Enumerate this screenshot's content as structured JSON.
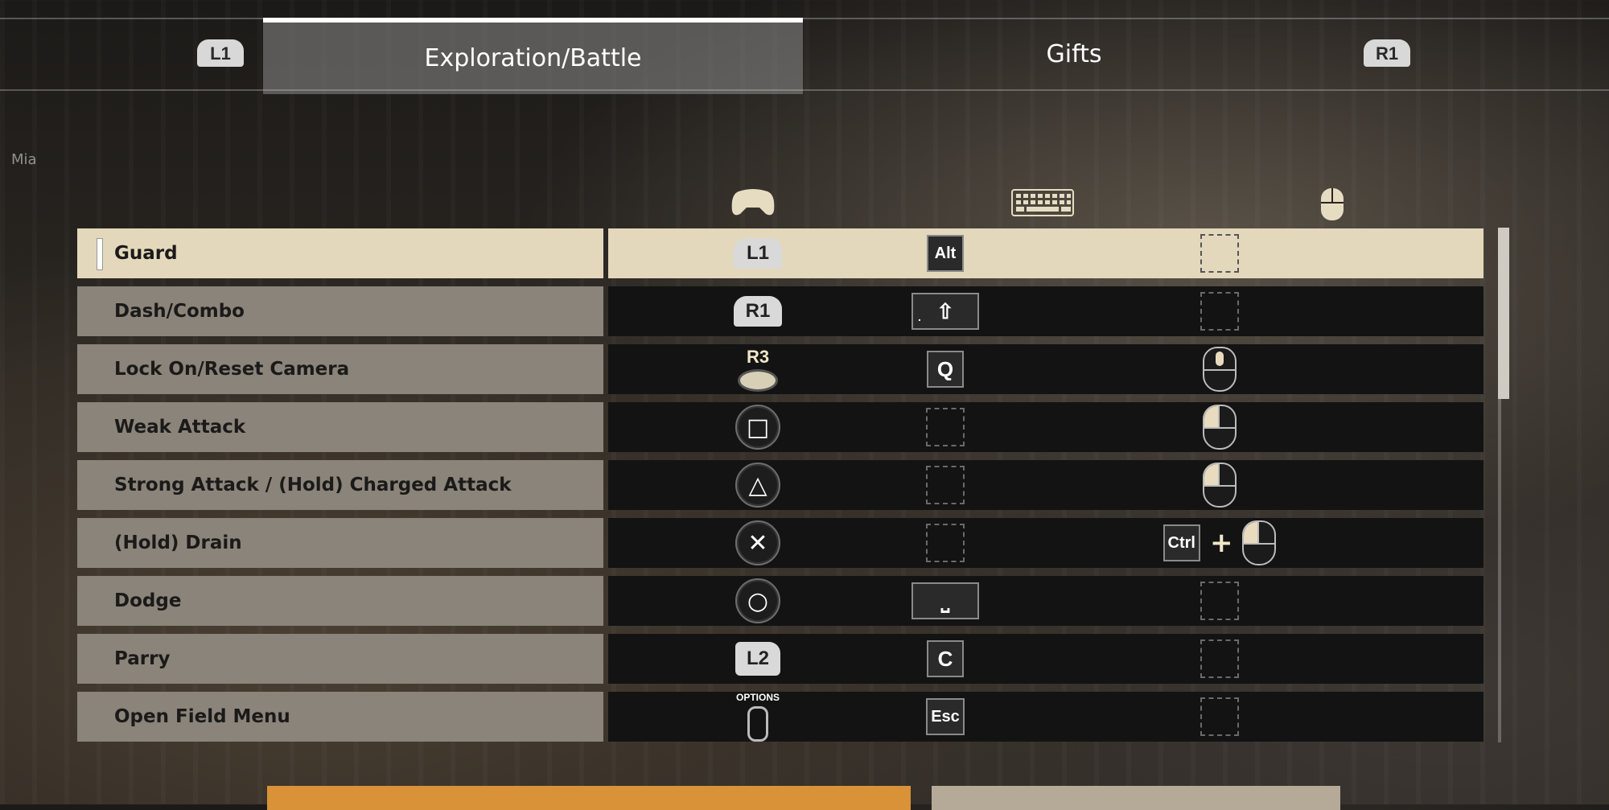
{
  "tabs": {
    "left_shoulder": "L1",
    "right_shoulder": "R1",
    "items": [
      {
        "label": "Exploration/Battle",
        "active": true
      },
      {
        "label": "Gifts",
        "active": false
      }
    ]
  },
  "character_name": "Mia",
  "columns": {
    "controller_icon": "gamepad-icon",
    "keyboard_icon": "keyboard-icon",
    "mouse_icon": "mouse-icon"
  },
  "bindings": [
    {
      "action": "Guard",
      "pad": "L1",
      "key": "Alt",
      "mouse": ""
    },
    {
      "action": "Dash/Combo",
      "pad": "R1",
      "key": "⇧",
      "mouse": ""
    },
    {
      "action": "Lock On/Reset Camera",
      "pad": "R3",
      "key": "Q",
      "mouse": "middle-click"
    },
    {
      "action": "Weak Attack",
      "pad": "□",
      "key": "",
      "mouse": "left-click"
    },
    {
      "action": "Strong Attack / (Hold) Charged Attack",
      "pad": "△",
      "key": "",
      "mouse": "left-click"
    },
    {
      "action": "(Hold) Drain",
      "pad": "✕",
      "key": "",
      "mouse_mod": "Ctrl",
      "mouse_plus": "+",
      "mouse": "left-click"
    },
    {
      "action": "Dodge",
      "pad": "○",
      "key": "⎵",
      "mouse": ""
    },
    {
      "action": "Parry",
      "pad": "L2",
      "key": "C",
      "mouse": ""
    },
    {
      "action": "Open Field Menu",
      "pad": "OPTIONS",
      "key": "Esc",
      "mouse": ""
    }
  ],
  "colors": {
    "selected_row": "#e3d7bc",
    "row_label_bg": "#8a847b",
    "row_bind_bg": "#131313",
    "accent_orange": "#d99238"
  }
}
